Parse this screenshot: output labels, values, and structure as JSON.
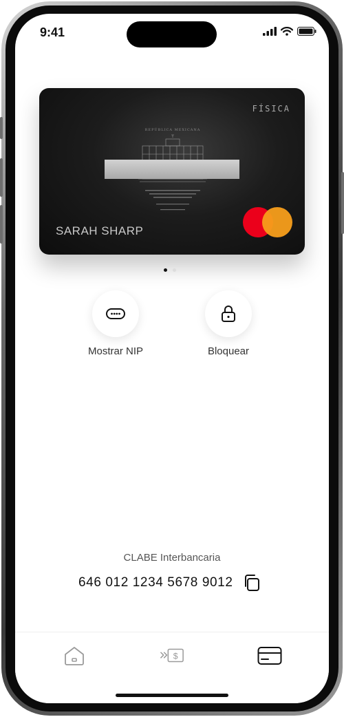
{
  "status_bar": {
    "time": "9:41"
  },
  "card": {
    "type_label": "FÍSICA",
    "holder_name": "SARAH SHARP",
    "emblem_text": "REPÚBLICA MEXICANA",
    "brand": "mastercard-logo",
    "pagination": {
      "count": 2,
      "active_index": 0
    }
  },
  "actions": [
    {
      "label": "Mostrar NIP",
      "icon": "pin-dots-icon"
    },
    {
      "label": "Bloquear",
      "icon": "lock-icon"
    }
  ],
  "clabe": {
    "title": "CLABE Interbancaria",
    "number": "646 012 1234 5678 9012",
    "copy_icon": "copy-icon"
  },
  "tabbar": {
    "items": [
      {
        "icon": "home-icon",
        "active": false
      },
      {
        "icon": "transfer-money-icon",
        "active": false
      },
      {
        "icon": "card-icon",
        "active": true
      }
    ]
  },
  "colors": {
    "mastercard_red": "#eb001b",
    "mastercard_orange": "#f79e1b",
    "card_bg": "#1c1c1c"
  }
}
